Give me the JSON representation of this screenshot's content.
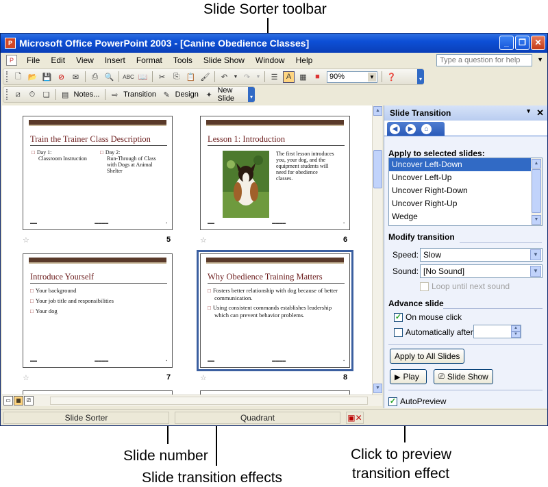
{
  "callouts": {
    "toolbar": "Slide Sorter toolbar",
    "slide_number": "Slide number",
    "transition_effects": "Slide transition effects",
    "preview": "Click to preview",
    "preview2": "transition effect"
  },
  "window": {
    "title": "Microsoft Office PowerPoint 2003 - [Canine Obedience Classes]"
  },
  "menu": {
    "items": [
      "File",
      "Edit",
      "View",
      "Insert",
      "Format",
      "Tools",
      "Slide Show",
      "Window",
      "Help"
    ],
    "ask_placeholder": "Type a question for help"
  },
  "toolbar": {
    "zoom": "90%",
    "notes_label": "Notes...",
    "transition_label": "Transition",
    "design_label": "Design",
    "new_slide_label": "New Slide"
  },
  "slides": [
    {
      "number": "5",
      "title": "Train the Trainer Class Description",
      "col1_bullet": "Day 1:",
      "col1_text": "Classroom Instruction",
      "col2_bullet": "Day 2:",
      "col2_line1": "Run-Through of Class",
      "col2_line2": "with Dogs at Animal",
      "col2_line3": "Shelter"
    },
    {
      "number": "6",
      "title": "Lesson 1: Introduction",
      "body1": "The first lesson introduces",
      "body2": "you, your dog, and the",
      "body3": "equipment students will",
      "body4": "need for obedience",
      "body5": "classes."
    },
    {
      "number": "7",
      "title": "Introduce Yourself",
      "bullets": [
        "Your background",
        "Your job title and responsibilities",
        "Your dog"
      ]
    },
    {
      "number": "8",
      "title": "Why Obedience Training Matters",
      "bullets": [
        "Fosters better relationship with dog because of better communication.",
        "Using consistent commands establishes leadership which can prevent behavior problems."
      ]
    }
  ],
  "status": {
    "view": "Slide Sorter",
    "design": "Quadrant"
  },
  "pane": {
    "title": "Slide Transition",
    "apply_label": "Apply to selected slides:",
    "transitions": [
      "Uncover Left-Down",
      "Uncover Left-Up",
      "Uncover Right-Down",
      "Uncover Right-Up",
      "Wedge"
    ],
    "selected_transition": "Uncover Left-Down",
    "modify_label": "Modify transition",
    "speed_label": "Speed:",
    "speed_value": "Slow",
    "sound_label": "Sound:",
    "sound_value": "[No Sound]",
    "loop_label": "Loop until next sound",
    "advance_label": "Advance slide",
    "on_click_label": "On mouse click",
    "on_click_checked": true,
    "auto_label": "Automatically after",
    "apply_all_label": "Apply to All Slides",
    "play_label": "Play",
    "slideshow_label": "Slide Show",
    "autopreview_label": "AutoPreview",
    "autopreview_checked": true
  },
  "colors": {
    "titlebar": "#0d4fd6",
    "selection": "#316ac5",
    "slide_title": "#6a1a1a",
    "slide_bar": "#5a3a2a"
  }
}
